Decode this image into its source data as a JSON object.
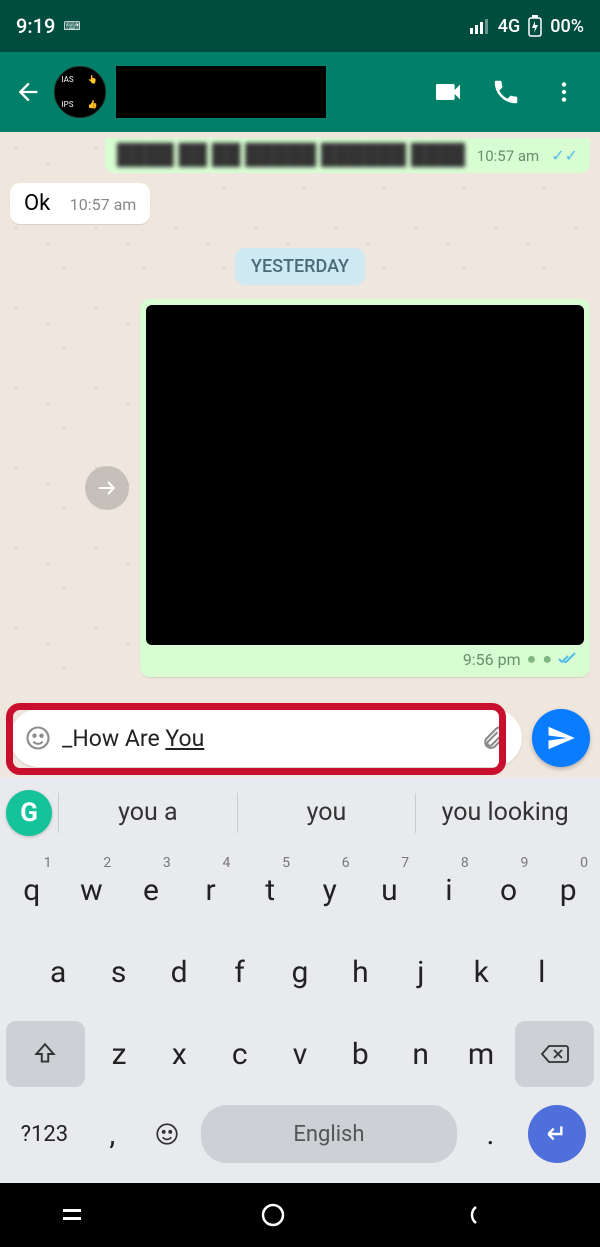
{
  "status": {
    "time": "9:19",
    "network": "4G",
    "battery": "00%"
  },
  "appbar": {
    "contact_name": ""
  },
  "chat": {
    "partial_msg": {
      "text": "████ ██ ██ █████ ██████ ████",
      "time": "10:57 am"
    },
    "msg_in": {
      "text": "Ok",
      "time": "10:57 am"
    },
    "date_chip": "YESTERDAY",
    "media_out": {
      "time": "9:56 pm"
    }
  },
  "input": {
    "text_prefix": "_How Are ",
    "text_underlined": "You"
  },
  "keyboard": {
    "suggestions": [
      "you a",
      "you",
      "you looking"
    ],
    "row1": [
      "q",
      "w",
      "e",
      "r",
      "t",
      "y",
      "u",
      "i",
      "o",
      "p"
    ],
    "nums": [
      "1",
      "2",
      "3",
      "4",
      "5",
      "6",
      "7",
      "8",
      "9",
      "0"
    ],
    "row2": [
      "a",
      "s",
      "d",
      "f",
      "g",
      "h",
      "j",
      "k",
      "l"
    ],
    "row3": [
      "z",
      "x",
      "c",
      "v",
      "b",
      "n",
      "m"
    ],
    "sym_key": "?123",
    "comma": ",",
    "period": ".",
    "space_label": "English"
  }
}
